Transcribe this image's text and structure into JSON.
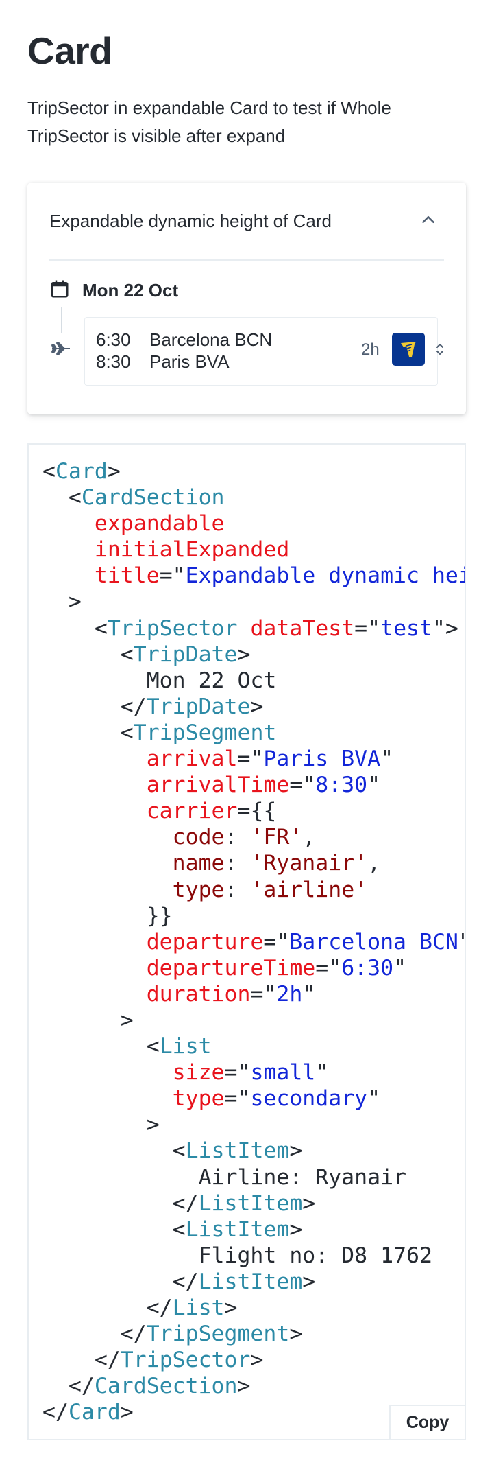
{
  "page": {
    "title": "Card",
    "description": "TripSector in expandable Card to test if Whole TripSector is visible after expand"
  },
  "card": {
    "title": "Expandable dynamic height of Card",
    "trip_date": "Mon 22 Oct",
    "segment": {
      "departure_time": "6:30",
      "departure": "Barcelona BCN",
      "arrival_time": "8:30",
      "arrival": "Paris BVA",
      "duration": "2h",
      "carrier_logo": "ryanair-harp-logo"
    }
  },
  "code": {
    "t1": "<",
    "t2": "Card",
    "t3": ">\n  <",
    "t4": "CardSection",
    "t5": "\n    ",
    "t6": "expandable",
    "t7": "\n    ",
    "t8": "initialExpanded",
    "t9": "\n    ",
    "t10": "title",
    "t11": "=\"",
    "t12": "Expandable dynamic height of Card",
    "t13": "\"\n  >\n    <",
    "t14": "TripSector",
    "t15": " ",
    "t16": "dataTest",
    "t17": "=\"",
    "t18": "test",
    "t19": "\">\n      <",
    "t20": "TripDate",
    "t21": ">\n        Mon 22 Oct\n      </",
    "t22": "TripDate",
    "t23": ">\n      <",
    "t24": "TripSegment",
    "t25": "\n        ",
    "t26": "arrival",
    "t27": "=\"",
    "t28": "Paris BVA",
    "t29": "\"\n        ",
    "t30": "arrivalTime",
    "t31": "=\"",
    "t32": "8:30",
    "t33": "\"\n        ",
    "t34": "carrier",
    "t35": "={{\n          ",
    "t36": "code",
    "t37": ": ",
    "t38": "'FR'",
    "t39": ",\n          ",
    "t40": "name",
    "t41": ": ",
    "t42": "'Ryanair'",
    "t43": ",\n          ",
    "t44": "type",
    "t45": ": ",
    "t46": "'airline'",
    "t47": "\n        }}\n        ",
    "t48": "departure",
    "t49": "=\"",
    "t50": "Barcelona BCN",
    "t51": "\"\n        ",
    "t52": "departureTime",
    "t53": "=\"",
    "t54": "6:30",
    "t55": "\"\n        ",
    "t56": "duration",
    "t57": "=\"",
    "t58": "2h",
    "t59": "\"\n      >\n        <",
    "t60": "List",
    "t61": "\n          ",
    "t62": "size",
    "t63": "=\"",
    "t64": "small",
    "t65": "\"\n          ",
    "t66": "type",
    "t67": "=\"",
    "t68": "secondary",
    "t69": "\"\n        >\n          <",
    "t70": "ListItem",
    "t71": ">\n            Airline: Ryanair\n          </",
    "t72": "ListItem",
    "t73": ">\n          <",
    "t74": "ListItem",
    "t75": ">\n            Flight no: D8 1762\n          </",
    "t76": "ListItem",
    "t77": ">\n        </",
    "t78": "List",
    "t79": ">\n      </",
    "t80": "TripSegment",
    "t81": ">\n    </",
    "t82": "TripSector",
    "t83": ">\n  </",
    "t84": "CardSection",
    "t85": ">\n</",
    "t86": "Card",
    "t87": ">"
  },
  "copy_label": "Copy",
  "colors": {
    "text": "#252a31",
    "tag": "#2c8aa6",
    "attr": "#e8141d",
    "value": "#1226d8",
    "object_value": "#8a0808",
    "logo_bg": "#073590",
    "logo_fg": "#f1c933"
  },
  "icons": [
    "calendar-icon",
    "chevron-up-icon",
    "airplane-icon",
    "chevron-up-down-icon"
  ]
}
